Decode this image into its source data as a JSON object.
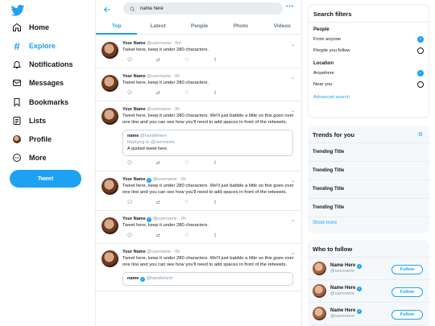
{
  "nav": {
    "logo": "twitter-bird-icon",
    "items": [
      {
        "label": "Home",
        "icon": "home-icon"
      },
      {
        "label": "Explore",
        "icon": "hashtag-icon",
        "active": true
      },
      {
        "label": "Notifications",
        "icon": "bell-icon"
      },
      {
        "label": "Messages",
        "icon": "envelope-icon"
      },
      {
        "label": "Bookmarks",
        "icon": "bookmark-icon"
      },
      {
        "label": "Lists",
        "icon": "list-icon"
      },
      {
        "label": "Profile",
        "icon": "avatar-icon"
      },
      {
        "label": "More",
        "icon": "more-circle-icon"
      }
    ],
    "tweet_button": "Tweet"
  },
  "search": {
    "value": "name here",
    "more": "•••"
  },
  "tabs": [
    {
      "label": "Top",
      "active": true
    },
    {
      "label": "Latest"
    },
    {
      "label": "People"
    },
    {
      "label": "Photo"
    },
    {
      "label": "Videos"
    }
  ],
  "tweets": [
    {
      "name": "Your Name",
      "meta": "@username · 0m",
      "verified": false,
      "text": "Tweet here, keep it under 280 characters."
    },
    {
      "name": "Your Name",
      "meta": "@username · 0h",
      "verified": false,
      "text": "Tweet here, keep it under 280 characters."
    },
    {
      "name": "Your Name",
      "meta": "@username · 0h",
      "verified": false,
      "text": "Tweet here, keep it under 280 characters. We'll just babble a little so this goes over one line and you can see how you'll need to add spaces in front of the retweets.",
      "quote": {
        "name": "name",
        "handle": "@handlehere",
        "reply": "Replying to @username",
        "text": "A quoted tweet here."
      }
    },
    {
      "name": "Your Name",
      "meta": "@username · 0h",
      "verified": true,
      "text": "Tweet here, keep it under 280 characters. We'll just babble a little so this goes over one line and you can see how you'll need to add spaces in front of the retweets."
    },
    {
      "name": "Your Name",
      "meta": "@username · 0h",
      "verified": true,
      "text": "Tweet here, keep it under 280 characters."
    },
    {
      "name": "Your Name",
      "meta": "@username · 0h",
      "verified": false,
      "text": "Tweet here, keep it under 280 characters. We'll just babble a little so this goes over one line and you can see how you'll need to add spaces in front of the retweets.",
      "quote": {
        "name": "name",
        "handle": "@handlehere",
        "reply": "",
        "text": ""
      }
    }
  ],
  "filters": {
    "title": "Search filters",
    "people_heading": "People",
    "people_options": [
      "From anyone",
      "People you follow"
    ],
    "location_heading": "Location",
    "location_options": [
      "Anywhere",
      "Near you"
    ],
    "advanced": "Advanced search"
  },
  "trends": {
    "title": "Trends for you",
    "items": [
      "Trending Title",
      "Trending Title",
      "Trending Title",
      "Trending Title"
    ],
    "show_more": "Show more"
  },
  "who_to_follow": {
    "title": "Who to follow",
    "people": [
      {
        "name": "Name Here",
        "handle": "@username",
        "button": "Follow"
      },
      {
        "name": "Name Here",
        "handle": "@username",
        "button": "Follow"
      },
      {
        "name": "Name Here",
        "handle": "@username",
        "button": "Follow"
      }
    ]
  },
  "colors": {
    "accent": "#1da1f2",
    "text": "#14171a",
    "muted": "#657786",
    "border": "#e6ecf0"
  }
}
